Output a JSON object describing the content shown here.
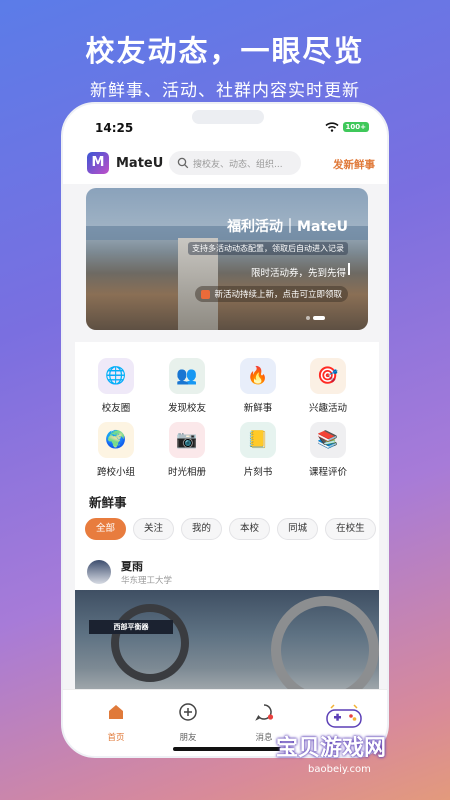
{
  "promo": {
    "title": "校友动态，一眼尽览",
    "subtitle": "新鲜事、活动、社群内容实时更新"
  },
  "status_bar": {
    "time": "14:25",
    "battery": "100+"
  },
  "header": {
    "app_name": "MateU",
    "logo_letter": "M",
    "search_placeholder": "搜校友、动态、组织...",
    "post_button": "发新鲜事"
  },
  "banner": {
    "title": "福利活动｜MateU",
    "line1": "支持多活动动态配置，领取后自动进入记录",
    "line2": "限时活动券，先到先得",
    "line3": "新活动持续上新，点击可立即领取"
  },
  "grid": [
    {
      "label": "校友圈",
      "icon": "globe-icon",
      "glyph": "🌐",
      "bg": "#efe9f8"
    },
    {
      "label": "发现校友",
      "icon": "people-icon",
      "glyph": "👥",
      "bg": "#e8f1ec"
    },
    {
      "label": "新鲜事",
      "icon": "fire-icon",
      "glyph": "🔥",
      "bg": "#e8eefa"
    },
    {
      "label": "兴趣活动",
      "icon": "target-icon",
      "glyph": "🎯",
      "bg": "#fbf0e4"
    },
    {
      "label": "跨校小组",
      "icon": "earth-icon",
      "glyph": "🌍",
      "bg": "#fdf4e2"
    },
    {
      "label": "时光相册",
      "icon": "camera-icon",
      "glyph": "📷",
      "bg": "#fbe8ea"
    },
    {
      "label": "片刻书",
      "icon": "book-icon",
      "glyph": "📒",
      "bg": "#e6f3ef"
    },
    {
      "label": "课程评价",
      "icon": "books-icon",
      "glyph": "📚",
      "bg": "#efeff1"
    }
  ],
  "feed": {
    "section_title": "新鲜事",
    "chips": [
      "全部",
      "关注",
      "我的",
      "本校",
      "同城",
      "在校生"
    ],
    "active_chip": 0,
    "post": {
      "user": "夏雨",
      "school": "华东理工大学",
      "photo_sign": "西部平衡器"
    }
  },
  "tabbar": [
    {
      "label": "首页",
      "icon": "home-icon",
      "active": true
    },
    {
      "label": "朋友",
      "icon": "plus-circle-icon",
      "active": false
    },
    {
      "label": "消息",
      "icon": "chat-bubble-icon",
      "active": false
    }
  ],
  "watermark": {
    "main": "宝贝游戏网",
    "sub": "baobeiy.com"
  },
  "colors": {
    "accent": "#e87c3e",
    "brand_start": "#3a56d4",
    "brand_end": "#c04fc9"
  }
}
